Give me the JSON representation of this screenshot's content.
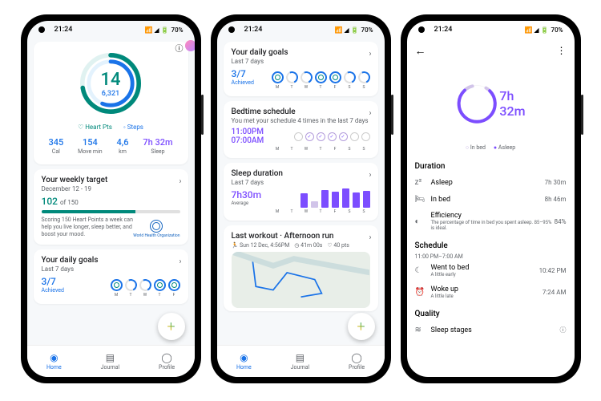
{
  "status": {
    "time": "21:24",
    "battery": "70%"
  },
  "days": [
    "M",
    "T",
    "W",
    "T",
    "F",
    "S",
    "S"
  ],
  "nav": {
    "home": "Home",
    "journal": "Journal",
    "profile": "Profile"
  },
  "p1": {
    "heart_pts": "14",
    "steps": "6,321",
    "toggle_hp": "Heart Pts",
    "toggle_steps": "Steps",
    "cal_v": "345",
    "cal_l": "Cal",
    "move_v": "154",
    "move_l": "Move min",
    "km_v": "4,6",
    "km_l": "km",
    "sleep_v": "7h 32m",
    "sleep_l": "Sleep",
    "target_title": "Your weekly target",
    "target_dates": "December 12 - 19",
    "target_val": "102",
    "target_of": "of 150",
    "target_desc": "Scoring 150 Heart Points a week can help you live longer, sleep better, and boost your mood.",
    "who": "World Health Organization",
    "daily_title": "Your daily goals",
    "daily_sub": "Last 7 days",
    "ach_v": "3/7",
    "ach_l": "Achieved"
  },
  "p2": {
    "daily_title": "Your daily goals",
    "daily_sub": "Last 7 days",
    "ach_v": "3/7",
    "ach_l": "Achieved",
    "bed_title": "Bedtime schedule",
    "bed_sub": "You met your schedule 4 times in the last 7 days",
    "bed_start": "11:00PM",
    "bed_end": "07:00AM",
    "sleep_title": "Sleep duration",
    "sleep_sub": "Last 7 days",
    "sleep_avg": "7h30m",
    "sleep_avg_l": "Average",
    "workout_title": "Last workout · Afternoon run",
    "workout_date": "Sun 12 Dec",
    "workout_time": "4:56PM",
    "workout_dur": "41m 00s",
    "workout_pts": "40 pts"
  },
  "p3": {
    "val_h": "7h",
    "val_m": "32m",
    "leg_inbed": "In bed",
    "leg_asleep": "Asleep",
    "dur_title": "Duration",
    "asleep_l": "Asleep",
    "asleep_v": "7h 30m",
    "inbed_l": "In bed",
    "inbed_v": "8h 46m",
    "eff_l": "Efficiency",
    "eff_v": "84%",
    "eff_sub": "The percentage of time in bed you spent asleep. 85–95% is ideal.",
    "sched_title": "Schedule",
    "sched_range": "11:00 PM–7:00 AM",
    "went_l": "Went to bed",
    "went_sub": "A little early",
    "went_v": "10:42 PM",
    "woke_l": "Woke up",
    "woke_sub": "A little late",
    "woke_v": "7:24 AM",
    "qual_title": "Quality",
    "stages_l": "Sleep stages"
  }
}
